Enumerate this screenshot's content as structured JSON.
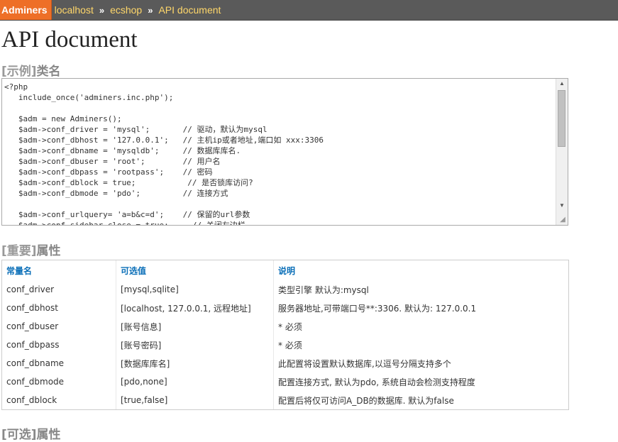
{
  "nav": {
    "brand": "Adminers",
    "separator": "»",
    "crumbs": [
      "localhost",
      "ecshop",
      "API document"
    ]
  },
  "page_title": "API document",
  "example": {
    "heading_bracket": "[示例]",
    "heading_text": "类名",
    "code": "<?php\n   include_once('adminers.inc.php');\n\n   $adm = new Adminers();\n   $adm->conf_driver = 'mysql';       // 驱动，默认为mysql\n   $adm->conf_dbhost = '127.0.0.1';   // 主机ip或者地址,端口如 xxx:3306\n   $adm->conf_dbname = 'mysqldb';     // 数据库库名.\n   $adm->conf_dbuser = 'root';        // 用户名\n   $adm->conf_dbpass = 'rootpass';    // 密码\n   $adm->conf_dblock = true;           // 是否锁库访问?\n   $adm->conf_dbmode = 'pdo';         // 连接方式\n\n   $adm->conf_urlquery= 'a=b&c=d';    // 保留的url参数\n   $adm->conf_sidebar_close = true;     // 关闭左边栏"
  },
  "important": {
    "heading_bracket": "[重要]",
    "heading_text": "属性",
    "columns": [
      "常量名",
      "可选值",
      "说明"
    ],
    "rows": [
      [
        "conf_driver",
        "[mysql,sqlite]",
        "类型引擎 默认为:mysql"
      ],
      [
        "conf_dbhost",
        "[localhost, 127.0.0.1, 远程地址]",
        "服务器地址,可带端口号**:3306. 默认为: 127.0.0.1"
      ],
      [
        "conf_dbuser",
        "[账号信息]",
        "* 必须"
      ],
      [
        "conf_dbpass",
        "[账号密码]",
        "* 必须"
      ],
      [
        "conf_dbname",
        "[数据库库名]",
        "此配置将设置默认数据库,以逗号分隔支持多个"
      ],
      [
        "conf_dbmode",
        "[pdo,none]",
        "配置连接方式, 默认为pdo, 系统自动会检测支持程度"
      ],
      [
        "conf_dblock",
        "[true,false]",
        "配置后将仅可访问A_DB的数据库. 默认为false"
      ]
    ]
  },
  "optional": {
    "heading_text": "[可选]属性"
  }
}
